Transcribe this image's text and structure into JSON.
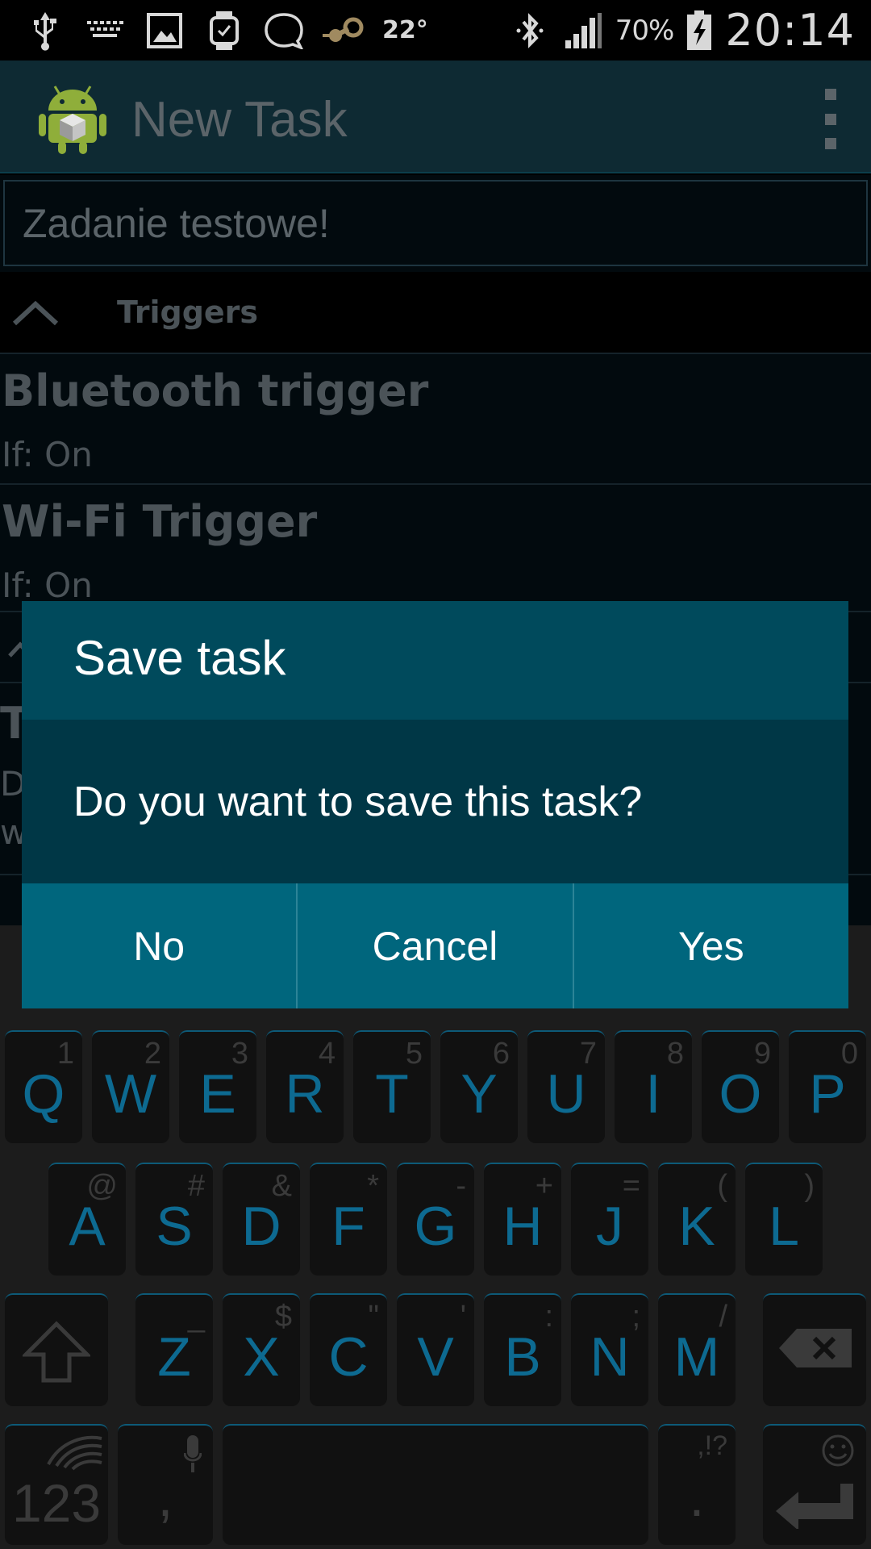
{
  "status_bar": {
    "temperature": "22°",
    "battery_percent": "70%",
    "time": "20:14",
    "left_icons": [
      "usb-icon",
      "keyboard-icon",
      "gallery-icon",
      "watch-icon",
      "bubble-icon",
      "steam-icon"
    ],
    "right_icons": [
      "bluetooth-icon",
      "signal-icon",
      "battery-charging-icon"
    ]
  },
  "app_bar": {
    "title": "New Task",
    "logo_icon": "android-logo-icon",
    "menu_icon": "overflow-menu-icon"
  },
  "task_name": {
    "value": "Zadanie testowe!"
  },
  "triggers_section": {
    "label": "Triggers",
    "items": [
      {
        "title": "Bluetooth trigger",
        "subtitle": "If: On"
      },
      {
        "title": "Wi-Fi Trigger",
        "subtitle": "If: On"
      }
    ]
  },
  "partial_section": {
    "letter_a": "T",
    "letter_b": "D",
    "letter_c": "w"
  },
  "dialog": {
    "title": "Save task",
    "message": "Do you want to save this task?",
    "buttons": {
      "no": "No",
      "cancel": "Cancel",
      "yes": "Yes"
    }
  },
  "keyboard": {
    "row1": [
      {
        "main": "Q",
        "alt": "1"
      },
      {
        "main": "W",
        "alt": "2"
      },
      {
        "main": "E",
        "alt": "3"
      },
      {
        "main": "R",
        "alt": "4"
      },
      {
        "main": "T",
        "alt": "5"
      },
      {
        "main": "Y",
        "alt": "6"
      },
      {
        "main": "U",
        "alt": "7"
      },
      {
        "main": "I",
        "alt": "8"
      },
      {
        "main": "O",
        "alt": "9"
      },
      {
        "main": "P",
        "alt": "0"
      }
    ],
    "row2": [
      {
        "main": "A",
        "alt": "@"
      },
      {
        "main": "S",
        "alt": "#"
      },
      {
        "main": "D",
        "alt": "&"
      },
      {
        "main": "F",
        "alt": "*"
      },
      {
        "main": "G",
        "alt": "-"
      },
      {
        "main": "H",
        "alt": "+"
      },
      {
        "main": "J",
        "alt": "="
      },
      {
        "main": "K",
        "alt": "("
      },
      {
        "main": "L",
        "alt": ")"
      }
    ],
    "row3": [
      {
        "main": "Z",
        "alt": "_"
      },
      {
        "main": "X",
        "alt": "$"
      },
      {
        "main": "C",
        "alt": "\""
      },
      {
        "main": "V",
        "alt": "'"
      },
      {
        "main": "B",
        "alt": ":"
      },
      {
        "main": "N",
        "alt": ";"
      },
      {
        "main": "M",
        "alt": "/"
      }
    ],
    "symbols_key": "123",
    "comma_key": ",",
    "period_key": ".",
    "period_alt": ",!?"
  },
  "colors": {
    "accent": "#00667d",
    "dialog_header": "#004a5c",
    "dialog_body": "#003746",
    "key_text": "#0d6a91"
  }
}
